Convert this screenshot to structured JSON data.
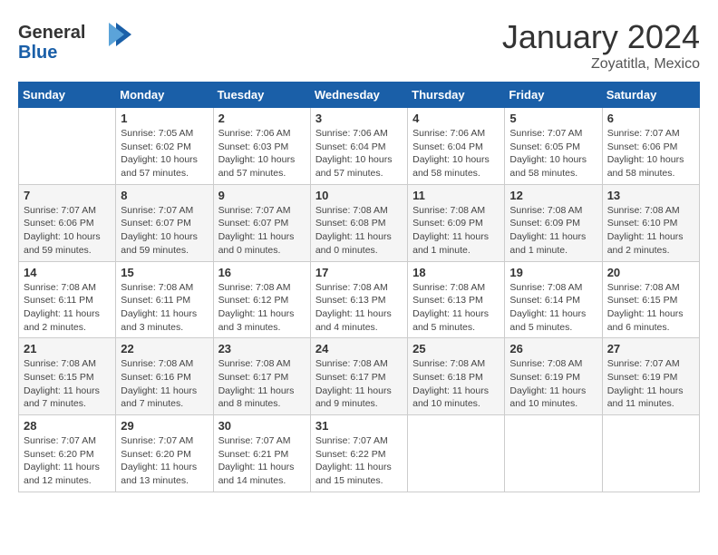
{
  "header": {
    "logo_line1": "General",
    "logo_line2": "Blue",
    "month": "January 2024",
    "location": "Zoyatitla, Mexico"
  },
  "weekdays": [
    "Sunday",
    "Monday",
    "Tuesday",
    "Wednesday",
    "Thursday",
    "Friday",
    "Saturday"
  ],
  "weeks": [
    [
      {
        "day": "",
        "info": ""
      },
      {
        "day": "1",
        "info": "Sunrise: 7:05 AM\nSunset: 6:02 PM\nDaylight: 10 hours and 57 minutes."
      },
      {
        "day": "2",
        "info": "Sunrise: 7:06 AM\nSunset: 6:03 PM\nDaylight: 10 hours and 57 minutes."
      },
      {
        "day": "3",
        "info": "Sunrise: 7:06 AM\nSunset: 6:04 PM\nDaylight: 10 hours and 57 minutes."
      },
      {
        "day": "4",
        "info": "Sunrise: 7:06 AM\nSunset: 6:04 PM\nDaylight: 10 hours and 58 minutes."
      },
      {
        "day": "5",
        "info": "Sunrise: 7:07 AM\nSunset: 6:05 PM\nDaylight: 10 hours and 58 minutes."
      },
      {
        "day": "6",
        "info": "Sunrise: 7:07 AM\nSunset: 6:06 PM\nDaylight: 10 hours and 58 minutes."
      }
    ],
    [
      {
        "day": "7",
        "info": "Sunrise: 7:07 AM\nSunset: 6:06 PM\nDaylight: 10 hours and 59 minutes."
      },
      {
        "day": "8",
        "info": "Sunrise: 7:07 AM\nSunset: 6:07 PM\nDaylight: 10 hours and 59 minutes."
      },
      {
        "day": "9",
        "info": "Sunrise: 7:07 AM\nSunset: 6:07 PM\nDaylight: 11 hours and 0 minutes."
      },
      {
        "day": "10",
        "info": "Sunrise: 7:08 AM\nSunset: 6:08 PM\nDaylight: 11 hours and 0 minutes."
      },
      {
        "day": "11",
        "info": "Sunrise: 7:08 AM\nSunset: 6:09 PM\nDaylight: 11 hours and 1 minute."
      },
      {
        "day": "12",
        "info": "Sunrise: 7:08 AM\nSunset: 6:09 PM\nDaylight: 11 hours and 1 minute."
      },
      {
        "day": "13",
        "info": "Sunrise: 7:08 AM\nSunset: 6:10 PM\nDaylight: 11 hours and 2 minutes."
      }
    ],
    [
      {
        "day": "14",
        "info": "Sunrise: 7:08 AM\nSunset: 6:11 PM\nDaylight: 11 hours and 2 minutes."
      },
      {
        "day": "15",
        "info": "Sunrise: 7:08 AM\nSunset: 6:11 PM\nDaylight: 11 hours and 3 minutes."
      },
      {
        "day": "16",
        "info": "Sunrise: 7:08 AM\nSunset: 6:12 PM\nDaylight: 11 hours and 3 minutes."
      },
      {
        "day": "17",
        "info": "Sunrise: 7:08 AM\nSunset: 6:13 PM\nDaylight: 11 hours and 4 minutes."
      },
      {
        "day": "18",
        "info": "Sunrise: 7:08 AM\nSunset: 6:13 PM\nDaylight: 11 hours and 5 minutes."
      },
      {
        "day": "19",
        "info": "Sunrise: 7:08 AM\nSunset: 6:14 PM\nDaylight: 11 hours and 5 minutes."
      },
      {
        "day": "20",
        "info": "Sunrise: 7:08 AM\nSunset: 6:15 PM\nDaylight: 11 hours and 6 minutes."
      }
    ],
    [
      {
        "day": "21",
        "info": "Sunrise: 7:08 AM\nSunset: 6:15 PM\nDaylight: 11 hours and 7 minutes."
      },
      {
        "day": "22",
        "info": "Sunrise: 7:08 AM\nSunset: 6:16 PM\nDaylight: 11 hours and 7 minutes."
      },
      {
        "day": "23",
        "info": "Sunrise: 7:08 AM\nSunset: 6:17 PM\nDaylight: 11 hours and 8 minutes."
      },
      {
        "day": "24",
        "info": "Sunrise: 7:08 AM\nSunset: 6:17 PM\nDaylight: 11 hours and 9 minutes."
      },
      {
        "day": "25",
        "info": "Sunrise: 7:08 AM\nSunset: 6:18 PM\nDaylight: 11 hours and 10 minutes."
      },
      {
        "day": "26",
        "info": "Sunrise: 7:08 AM\nSunset: 6:19 PM\nDaylight: 11 hours and 10 minutes."
      },
      {
        "day": "27",
        "info": "Sunrise: 7:07 AM\nSunset: 6:19 PM\nDaylight: 11 hours and 11 minutes."
      }
    ],
    [
      {
        "day": "28",
        "info": "Sunrise: 7:07 AM\nSunset: 6:20 PM\nDaylight: 11 hours and 12 minutes."
      },
      {
        "day": "29",
        "info": "Sunrise: 7:07 AM\nSunset: 6:20 PM\nDaylight: 11 hours and 13 minutes."
      },
      {
        "day": "30",
        "info": "Sunrise: 7:07 AM\nSunset: 6:21 PM\nDaylight: 11 hours and 14 minutes."
      },
      {
        "day": "31",
        "info": "Sunrise: 7:07 AM\nSunset: 6:22 PM\nDaylight: 11 hours and 15 minutes."
      },
      {
        "day": "",
        "info": ""
      },
      {
        "day": "",
        "info": ""
      },
      {
        "day": "",
        "info": ""
      }
    ]
  ]
}
